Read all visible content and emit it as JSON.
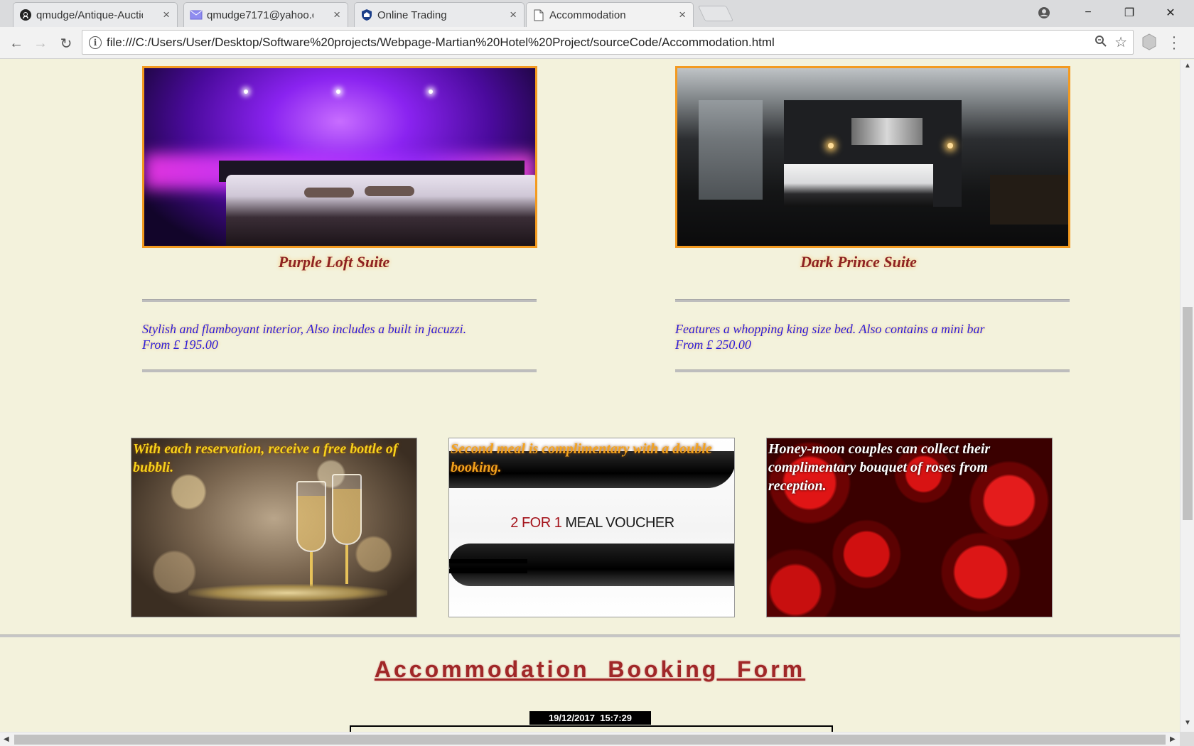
{
  "browser": {
    "tabs": [
      {
        "label": "qmudge/Antique-Auction",
        "icon": "github-icon"
      },
      {
        "label": "qmudge7171@yahoo.com",
        "icon": "mail-icon"
      },
      {
        "label": "Online Trading",
        "icon": "bank-shield-icon"
      },
      {
        "label": "Accommodation",
        "icon": "page-icon",
        "active": true
      }
    ],
    "close_glyph": "×",
    "url": "file:///C:/Users/User/Desktop/Software%20projects/Webpage-Martian%20Hotel%20Project/sourceCode/Accommodation.html",
    "window_controls": {
      "minimize": "−",
      "restore": "❐",
      "close": "✕"
    },
    "nav": {
      "back": "←",
      "forward": "→",
      "reload": "↻"
    }
  },
  "suites": [
    {
      "title": "Purple Loft Suite",
      "description": "Stylish and flamboyant interior, Also includes a built in jacuzzi.",
      "price": "From £ 195.00"
    },
    {
      "title": "Dark Prince Suite",
      "description": "Features a whopping king size bed. Also contains a mini bar",
      "price": "From £ 250.00"
    }
  ],
  "promos": [
    {
      "text": "With each reservation, receive a free bottle of bubbli.",
      "color": "#f7d21b"
    },
    {
      "text": "Second meal is complimentary with a double booking.",
      "color": "#f5a31c",
      "voucher_red": "2 FOR 1",
      "voucher_black": "MEAL VOUCHER"
    },
    {
      "text": "Honey-moon couples can collect their complimentary bouquet of roses from reception.",
      "color": "#ffffff"
    }
  ],
  "booking": {
    "title": "Accommodation  Booking  Form",
    "datetime": "19/12/2017  15:7:29"
  },
  "colors": {
    "page_bg": "#f3f2dc",
    "suite_title": "#8e2222",
    "suite_desc": "#2b1bd8",
    "image_border": "#f39a1f",
    "booking_title": "#a02828"
  }
}
